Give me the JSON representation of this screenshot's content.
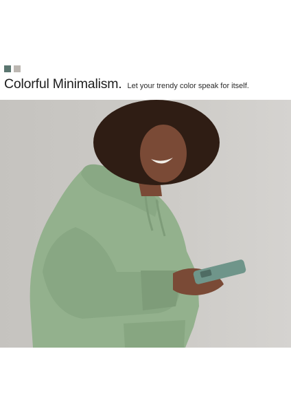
{
  "swatches": [
    {
      "color": "#5b7670"
    },
    {
      "color": "#bcb7b2"
    }
  ],
  "headline": {
    "title": "Colorful Minimalism.",
    "subtitle": "Let your trendy color speak for itself."
  },
  "photo": {
    "colors": {
      "wall": "#c9c7c3",
      "hoodie": "#93b18d",
      "hoodie_shadow": "#7e9c79",
      "skin": "#7a4a36",
      "hair": "#2f1d14",
      "phone": "#6f958a"
    }
  }
}
